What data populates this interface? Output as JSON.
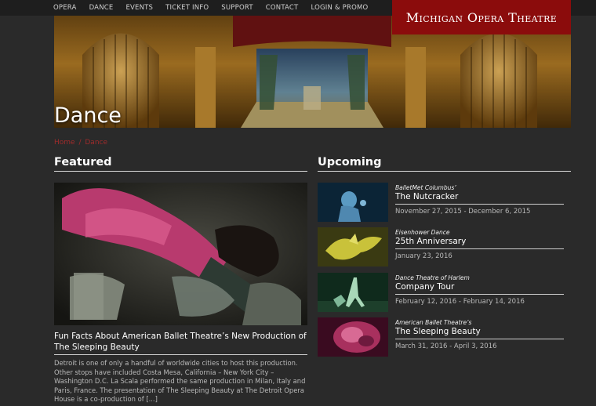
{
  "nav": {
    "items": [
      "OPERA",
      "DANCE",
      "EVENTS",
      "TICKET INFO",
      "SUPPORT",
      "CONTACT",
      "LOGIN & PROMO"
    ]
  },
  "logo": {
    "text": "Michigan Opera Theatre"
  },
  "hero": {
    "title": "Dance"
  },
  "breadcrumb": {
    "home": "Home",
    "separator": "/",
    "current": "Dance"
  },
  "featured": {
    "heading": "Featured",
    "title": "Fun Facts About American Ballet Theatre’s New Production of The Sleeping Beauty",
    "excerpt": "Detroit is one of only a handful of worldwide cities to host this production. Other stops have included Costa Mesa, California – New York City – Washington D.C. La Scala performed the same production in Milan, Italy and Paris, France. The presentation of The Sleeping Beauty at The Detroit Opera House is a co-production of [...]"
  },
  "upcoming": {
    "heading": "Upcoming",
    "events": [
      {
        "company": "BalletMet Columbus’",
        "name": "The Nutcracker",
        "dates": "November 27, 2015 - December 6, 2015"
      },
      {
        "company": "Eisenhower Dance",
        "name": "25th Anniversary",
        "dates": "January 23, 2016"
      },
      {
        "company": "Dance Theatre of Harlem",
        "name": "Company Tour",
        "dates": "February 12, 2016 - February 14, 2016"
      },
      {
        "company": "American Ballet Theatre’s",
        "name": "The Sleeping Beauty",
        "dates": "March 31, 2016 - April 3, 2016"
      }
    ]
  },
  "colors": {
    "accent": "#8b0c0c",
    "breadcrumb": "#9e2b2b",
    "background": "#2a2a2a"
  }
}
